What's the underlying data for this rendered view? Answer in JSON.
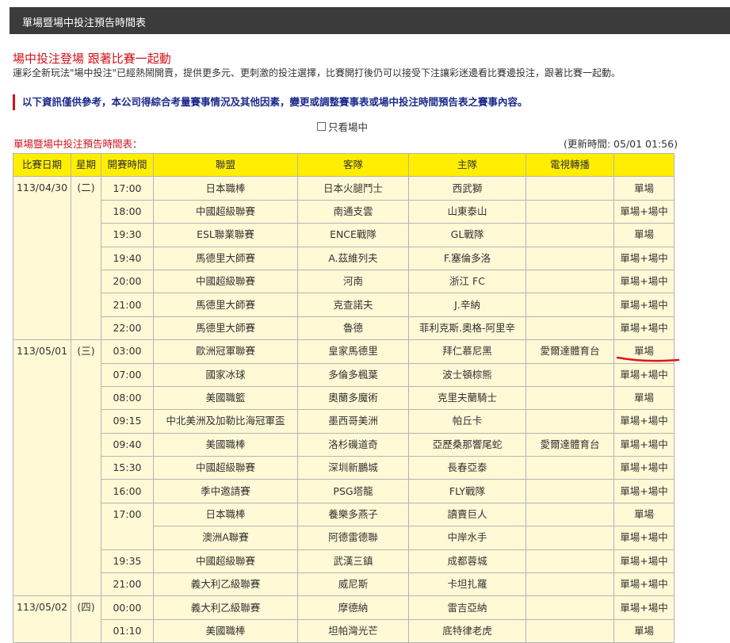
{
  "page_title": "單場暨場中投注預告時間表",
  "headline": "場中投注登場 跟著比賽一起動",
  "description": "運彩全新玩法\"場中投注\"已經熱鬧開賣，提供更多元、更刺激的投注選擇，比賽開打後仍可以接受下注讓彩迷邊看比賽邊投注，跟著比賽一起動。",
  "notice": "以下資訊僅供參考，本公司得綜合考量賽事情況及其他因素，變更或調整賽事表或場中投注時間預告表之賽事內容。",
  "only_live_label": "只看場中",
  "table_title": "單場暨場中投注預告時間表：",
  "updated": "(更新時間: 05/01 01:56)",
  "columns": [
    "比賽日期",
    "星期",
    "開賽時間",
    "聯盟",
    "客隊",
    "主隊",
    "電視轉播",
    ""
  ],
  "days": [
    {
      "date": "113/04/30",
      "dow": "(二)",
      "rows": [
        {
          "time": "17:00",
          "league": "日本職棒",
          "away": "日本火腿鬥士",
          "home": "西武獅",
          "tv": "",
          "type": "單場"
        },
        {
          "time": "18:00",
          "league": "中國超級聯賽",
          "away": "南通支雲",
          "home": "山東泰山",
          "tv": "",
          "type": "單場+場中"
        },
        {
          "time": "19:30",
          "league": "ESL聯業聯賽",
          "away": "ENCE戰隊",
          "home": "GL戰隊",
          "tv": "",
          "type": "單場"
        },
        {
          "time": "19:40",
          "league": "馬德里大師賽",
          "away": "A.茲維列夫",
          "home": "F.塞倫多洛",
          "tv": "",
          "type": "單場+場中"
        },
        {
          "time": "20:00",
          "league": "中國超級聯賽",
          "away": "河南",
          "home": "浙江 FC",
          "tv": "",
          "type": "單場+場中"
        },
        {
          "time": "21:00",
          "league": "馬德里大師賽",
          "away": "克查諾夫",
          "home": "J.辛納",
          "tv": "",
          "type": "單場+場中"
        },
        {
          "time": "22:00",
          "league": "馬德里大師賽",
          "away": "魯德",
          "home": "菲利克斯.奧格-阿里辛",
          "tv": "",
          "type": "單場+場中"
        }
      ]
    },
    {
      "date": "113/05/01",
      "dow": "(三)",
      "rows": [
        {
          "time": "03:00",
          "league": "歐洲冠軍聯賽",
          "away": "皇家馬德里",
          "home": "拜仁慕尼黑",
          "tv": "愛爾達體育台",
          "type": "單場"
        },
        {
          "time": "07:00",
          "league": "國家冰球",
          "away": "多倫多楓葉",
          "home": "波士頓棕熊",
          "tv": "",
          "type": "單場+場中"
        },
        {
          "time": "08:00",
          "league": "美國職籃",
          "away": "奧蘭多魔術",
          "home": "克里夫蘭騎士",
          "tv": "",
          "type": "單場"
        },
        {
          "time": "09:15",
          "league": "中北美洲及加勒比海冠軍盃",
          "away": "墨西哥美洲",
          "home": "帕丘卡",
          "tv": "",
          "type": "單場+場中"
        },
        {
          "time": "09:40",
          "league": "美國職棒",
          "away": "洛杉磯道奇",
          "home": "亞歷桑那響尾蛇",
          "tv": "愛爾達體育台",
          "type": "單場+場中"
        },
        {
          "time": "15:30",
          "league": "中國超級聯賽",
          "away": "深圳新鵬城",
          "home": "長春亞泰",
          "tv": "",
          "type": "單場+場中"
        },
        {
          "time": "16:00",
          "league": "季中邀請賽",
          "away": "PSG塔龍",
          "home": "FLY戰隊",
          "tv": "",
          "type": "單場+場中"
        },
        {
          "time": "17:00",
          "league": "日本職棒",
          "away": "養樂多燕子",
          "home": "讀賣巨人",
          "tv": "",
          "type": "單場"
        },
        {
          "time": "",
          "league": "澳洲A聯賽",
          "away": "阿德雷德聯",
          "home": "中岸水手",
          "tv": "",
          "type": "單場+場中"
        },
        {
          "time": "19:35",
          "league": "中國超級聯賽",
          "away": "武漢三鎮",
          "home": "成都蓉城",
          "tv": "",
          "type": "單場+場中"
        },
        {
          "time": "21:00",
          "league": "義大利乙級聯賽",
          "away": "威尼斯",
          "home": "卡坦扎羅",
          "tv": "",
          "type": "單場+場中"
        }
      ]
    },
    {
      "date": "113/05/02",
      "dow": "(四)",
      "rows": [
        {
          "time": "00:00",
          "league": "義大利乙級聯賽",
          "away": "摩德納",
          "home": "雷吉亞納",
          "tv": "",
          "type": "單場+場中"
        },
        {
          "time": "01:10",
          "league": "美國職棒",
          "away": "坦帕灣光芒",
          "home": "底特律老虎",
          "tv": "",
          "type": "單場"
        }
      ]
    }
  ],
  "colors": {
    "header_bar": "#3b3b3b",
    "accent_red": "#d0121a",
    "notice_blue": "#1b2a8a",
    "table_header": "#ffee00",
    "table_cell": "#fff9d6",
    "annotation_red": "#e0141e"
  }
}
